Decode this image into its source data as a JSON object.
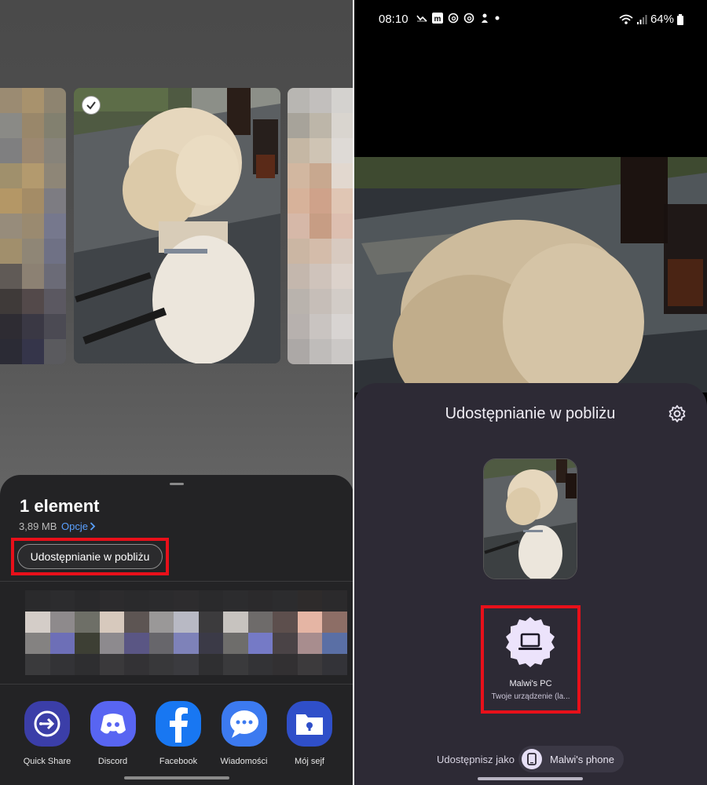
{
  "left": {
    "sheet": {
      "title": "1 element",
      "size": "3,89 MB",
      "options_link": "Opcje",
      "nearby_share_button": "Udostępnianie w pobliżu"
    },
    "apps": [
      {
        "label": "Quick Share",
        "icon": "quick-share-icon",
        "color": "#3b3ea8"
      },
      {
        "label": "Discord",
        "icon": "discord-icon",
        "color": "#5865f2"
      },
      {
        "label": "Facebook",
        "icon": "facebook-icon",
        "color": "#1877f2"
      },
      {
        "label": "Wiadomości",
        "icon": "messages-icon",
        "color": "#3c7af0"
      },
      {
        "label": "Mój sejf",
        "icon": "secure-folder-icon",
        "color": "#2f4fc9"
      }
    ]
  },
  "right": {
    "status": {
      "time": "08:10",
      "battery": "64%"
    },
    "panel": {
      "title": "Udostępnianie w pobliżu",
      "device_name": "Malwi's PC",
      "device_subtitle": "Twoje urządzenie (la...",
      "share_as_label": "Udostępnisz jako",
      "share_as_device": "Malwi's phone"
    }
  },
  "colors": {
    "highlight": "#e8101a",
    "link": "#5aa0ff",
    "panel_bg": "#2d2a35",
    "sheet_bg": "#232325"
  }
}
